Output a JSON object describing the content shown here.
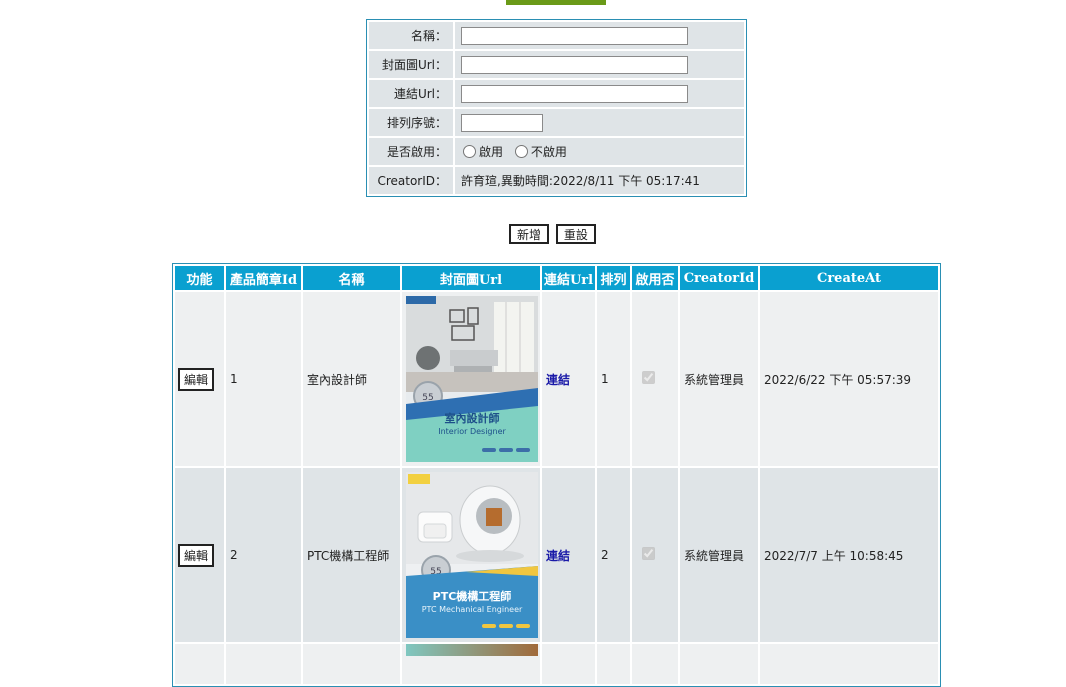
{
  "form": {
    "rows": [
      {
        "label": "名稱："
      },
      {
        "label": "封面圖Url："
      },
      {
        "label": "連結Url："
      },
      {
        "label": "排列序號："
      },
      {
        "label": "是否啟用："
      },
      {
        "label": "CreatorID："
      }
    ],
    "radio_enabled": "啟用",
    "radio_disabled": "不啟用",
    "creator_text": "許育瑄,異動時間:2022/8/11 下午 05:17:41"
  },
  "buttons": {
    "add": "新增",
    "reset": "重設"
  },
  "table": {
    "headers": [
      "功能",
      "產品簡章Id",
      "名稱",
      "封面圖Url",
      "連結Url",
      "排列",
      "啟用否",
      "CreatorId",
      "CreateAt"
    ],
    "rows": [
      {
        "action": "編輯",
        "id": "1",
        "name": "室內設計師",
        "link": "連結",
        "order": "1",
        "enabled": true,
        "creator": "系統管理員",
        "created_at": "2022/6/22 下午 05:57:39",
        "cover_title": "室內設計師",
        "cover_subtitle": "Interior Designer"
      },
      {
        "action": "編輯",
        "id": "2",
        "name": "PTC機構工程師",
        "link": "連結",
        "order": "2",
        "enabled": true,
        "creator": "系統管理員",
        "created_at": "2022/7/7 上午 10:58:45",
        "cover_title": "PTC機構工程師",
        "cover_subtitle": "PTC Mechanical Engineer"
      }
    ]
  },
  "colors": {
    "header_bg": "#0aa0d0",
    "form_border": "#2a8fb3",
    "row_light": "#eef0f1",
    "row_dark": "#dfe4e7",
    "banner": "#6a9a18",
    "link": "#1a1aa8"
  }
}
